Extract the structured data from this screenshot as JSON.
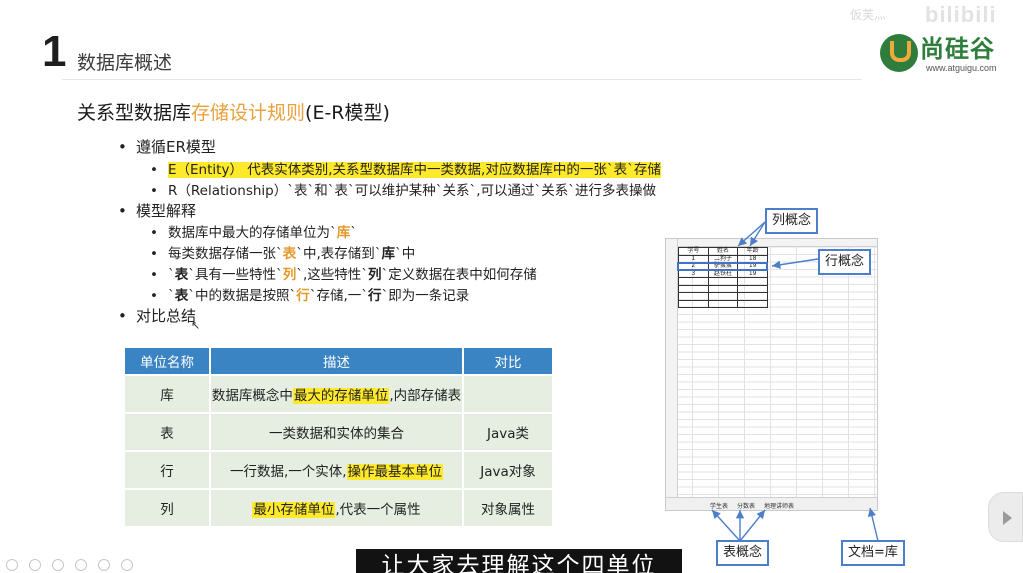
{
  "header": {
    "section_number": "1",
    "section_title": "数据库概述",
    "logo_text": "尚硅谷",
    "logo_url": "www.atguigu.com",
    "bili_watermark": "bilibili",
    "faint_watermark": "仮芙灬"
  },
  "subtitle": {
    "prefix": "关系型数据库",
    "highlight": "存储设计规则",
    "suffix": "(E-R模型)"
  },
  "bullets": {
    "er_model": "遵循ER模型",
    "entity_line": "E（Entity） 代表实体类别,关系型数据库中一类数据,对应数据库中的一张`表`存储",
    "relation_line": "R（Relationship）`表`和`表`可以维护某种`关系`,可以通过`关系`进行多表操做",
    "model_explain": "模型解释",
    "m1_a": "数据库中最大的存储单位为`",
    "m1_b": "库",
    "m1_c": "`",
    "m2_a": "每类数据存储一张`",
    "m2_b": "表",
    "m2_c": "`中,表存储到`",
    "m2_d": "库",
    "m2_e": "`中",
    "m3_a": "`",
    "m3_b": "表",
    "m3_c": "`具有一些特性`",
    "m3_d": "列",
    "m3_e": "`,这些特性`",
    "m3_f": "列",
    "m3_g": "`定义数据在表中如何存储",
    "m4_a": "`",
    "m4_b": "表",
    "m4_c": "`中的数据是按照`",
    "m4_d": "行",
    "m4_e": "`存储,一`",
    "m4_f": "行",
    "m4_g": "`即为一条记录",
    "summary": "对比总结"
  },
  "table": {
    "headers": [
      "单位名称",
      "描述",
      "对比"
    ],
    "rows": [
      {
        "unit": "库",
        "desc_a": "数据库概念中",
        "desc_hl": "最大的存储单位",
        "desc_b": ",内部存储表",
        "cmp": ""
      },
      {
        "unit": "表",
        "desc_a": "一类数据和实体的集合",
        "desc_hl": "",
        "desc_b": "",
        "cmp": "Java类"
      },
      {
        "unit": "行",
        "desc_a": "一行数据,一个实体,",
        "desc_hl": "操作最基本单位",
        "desc_b": "",
        "cmp": "Java对象"
      },
      {
        "unit": "列",
        "desc_a": "",
        "desc_hl": "最小存储单位",
        "desc_b": ",代表一个属性",
        "cmp": "对象属性"
      }
    ]
  },
  "diagram": {
    "col_label": "列概念",
    "row_label": "行概念",
    "table_label": "表概念",
    "doc_label": "文档=库",
    "sheet_headers": [
      "学号",
      "姓名",
      "年龄"
    ],
    "sheet_rows": [
      [
        "1",
        "二狗子",
        "18"
      ],
      [
        "2",
        "驴蛋蛋",
        "19"
      ],
      [
        "3",
        "赵铁柱",
        "19"
      ]
    ],
    "sheet_tabs": [
      "学生表",
      "分数表",
      "地理讲师表"
    ]
  },
  "subtitle_caption": "让大家去理解这个四单位",
  "colors": {
    "table_header": "#3b84c4",
    "table_cell": "#e5eee1",
    "highlight_yellow": "#ffe92b",
    "accent_orange": "#e9a13c",
    "logo_green": "#2f7d3c",
    "label_border": "#4d7ec9"
  }
}
